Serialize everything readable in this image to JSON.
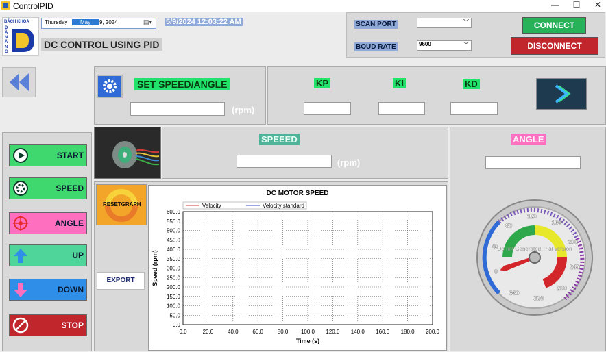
{
  "window": {
    "title": "ControlPID",
    "minimize": "—",
    "maximize": "☐",
    "close": "✕"
  },
  "logo": {
    "text_top": "BÁCH KHOA",
    "text_side": "ĐÀ NẴNG"
  },
  "datepicker": {
    "weekday": "Thursday",
    "month": "May",
    "day": "9, 2024"
  },
  "clock": "5/9/2024 12:03:22 AM",
  "heading": "DC CONTROL USING PID",
  "port": {
    "scan_label": "SCAN PORT",
    "scan_value": "",
    "baud_label": "BOUD RATE",
    "baud_value": "9600",
    "connect": "CONNECT",
    "disconnect": "DISCONNECT"
  },
  "setpoint": {
    "label": "SET SPEED/ANGLE",
    "value": "",
    "unit": "(rpm)"
  },
  "pid": {
    "kp_label": "KP",
    "ki_label": "KI",
    "kd_label": "KD",
    "kp": "",
    "ki": "",
    "kd": ""
  },
  "speed": {
    "label": "SPEEED",
    "value": "",
    "unit": "(rpm)"
  },
  "angle": {
    "label": "ANGLE",
    "value": ""
  },
  "controls": {
    "start": "START",
    "speed": "SPEED",
    "angle": "ANGLE",
    "up": "UP",
    "down": "DOWN",
    "stop": "STOP"
  },
  "resetgraph": "RESETGRAPH",
  "export": "EXPORT",
  "gauge": {
    "ticks": [
      "0",
      "40",
      "80",
      "120",
      "160",
      "200",
      "240",
      "280",
      "320",
      "360"
    ],
    "watermark": "Do not\nGenerated\nTrial\nversion",
    "needle_value": 0
  },
  "colors": {
    "green": "#21e36b",
    "red": "#c0262c",
    "pink": "#ff6fbf",
    "teal": "#22c27a",
    "blue": "#2f8fe8"
  },
  "chart_data": {
    "type": "line",
    "title": "DC MOTOR SPEED",
    "xlabel": "Time (s)",
    "ylabel": "Speed (rpm)",
    "xlim": [
      0,
      200
    ],
    "ylim": [
      0,
      600
    ],
    "xticks": [
      "0.0",
      "20.0",
      "40.0",
      "60.0",
      "80.0",
      "100.0",
      "120.0",
      "140.0",
      "160.0",
      "180.0",
      "200.0"
    ],
    "yticks": [
      "0.0",
      "50.0",
      "100.0",
      "150.0",
      "200.0",
      "250.0",
      "300.0",
      "350.0",
      "400.0",
      "450.0",
      "500.0",
      "550.0",
      "600.0"
    ],
    "series": [
      {
        "name": "Velocity",
        "color": "#d23a3a",
        "x": [],
        "y": []
      },
      {
        "name": "Velocity standard",
        "color": "#3a4ad2",
        "x": [],
        "y": []
      }
    ],
    "legend": "top-left",
    "grid": true
  }
}
